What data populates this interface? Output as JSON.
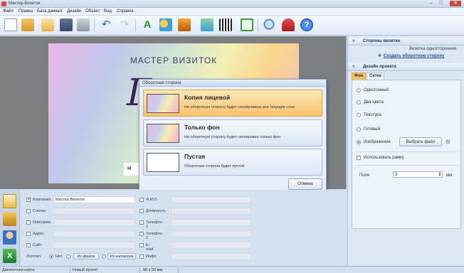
{
  "window": {
    "title": "Мастер Визиток",
    "minimize": "–",
    "maximize": "□",
    "close": "✕"
  },
  "menu": [
    "Файл",
    "Правка",
    "База данных",
    "Дизайн",
    "Объект",
    "Вид",
    "Справка"
  ],
  "toolbar_icons": [
    "new-file-icon",
    "open-folder-icon",
    "open-template-icon",
    "save-icon",
    "print-icon",
    "undo-icon",
    "redo-icon",
    "text-icon",
    "shapes-icon",
    "image-icon",
    "map-icon",
    "qr-code-icon",
    "crop-icon",
    "zoom-icon",
    "gift-icon",
    "help-icon"
  ],
  "card": {
    "title": "МАСТЕР ВИЗИТОК",
    "script_letter": "Г",
    "chip_letter": "Н"
  },
  "dialog": {
    "title": "Оборотная сторона",
    "options": [
      {
        "title": "Копия лицевой",
        "desc": "На оборотную сторону будут скопированы все текущие слои",
        "selected": true
      },
      {
        "title": "Только фон",
        "desc": "На оборотную сторону будет скопирован только фон",
        "selected": false
      },
      {
        "title": "Пустая",
        "desc": "Оборотная сторона будет пустой",
        "selected": false
      }
    ],
    "cancel": "Отмена"
  },
  "sidebar": {
    "sides_header": "Стороны визитки",
    "sides_note": "Визитка односторонняя.",
    "create_back_link": "Создать оборотную сторону",
    "design_header": "Дизайн проекта",
    "tabs": [
      "Фон",
      "Сетка"
    ],
    "background_options": [
      {
        "label": "Однотонный",
        "selected": false
      },
      {
        "label": "Два цвета",
        "selected": false
      },
      {
        "label": "Текстура",
        "selected": false
      },
      {
        "label": "Готовый",
        "selected": false
      },
      {
        "label": "Изображение",
        "selected": true
      }
    ],
    "choose_file": "Выбрать файл",
    "use_frame_label": "Использовать рамку",
    "use_frame_checked": false,
    "margins_label": "Поля",
    "margins_value": "3",
    "margins_unit": "мм"
  },
  "fields_left": [
    {
      "label": "Компания",
      "value": "Мастер Визиток",
      "checked": true
    },
    {
      "label": "Слоган",
      "value": "",
      "checked": false
    },
    {
      "label": "Описание",
      "value": "",
      "checked": false
    },
    {
      "label": "Адрес",
      "value": "",
      "checked": false
    },
    {
      "label": "Сайт",
      "value": "",
      "checked": false
    }
  ],
  "logo_row": {
    "label": "Логотип",
    "none": "Нет",
    "from_file": "Из файла",
    "from_catalog": "Из каталога"
  },
  "fields_right": [
    {
      "label": "Ф.И.О.",
      "value": "",
      "checked": false
    },
    {
      "label": "Должность",
      "value": "",
      "checked": false
    },
    {
      "label": "Телефон 1",
      "value": "",
      "checked": false
    },
    {
      "label": "Телефон 2",
      "value": "",
      "checked": false
    },
    {
      "label": "E-mail",
      "value": "",
      "checked": false
    },
    {
      "label": "Инфо",
      "value": "",
      "checked": false
    }
  ],
  "status": {
    "type": "Дисконтная карта",
    "project": "Новый проект",
    "size": "90 x 50 мм"
  }
}
